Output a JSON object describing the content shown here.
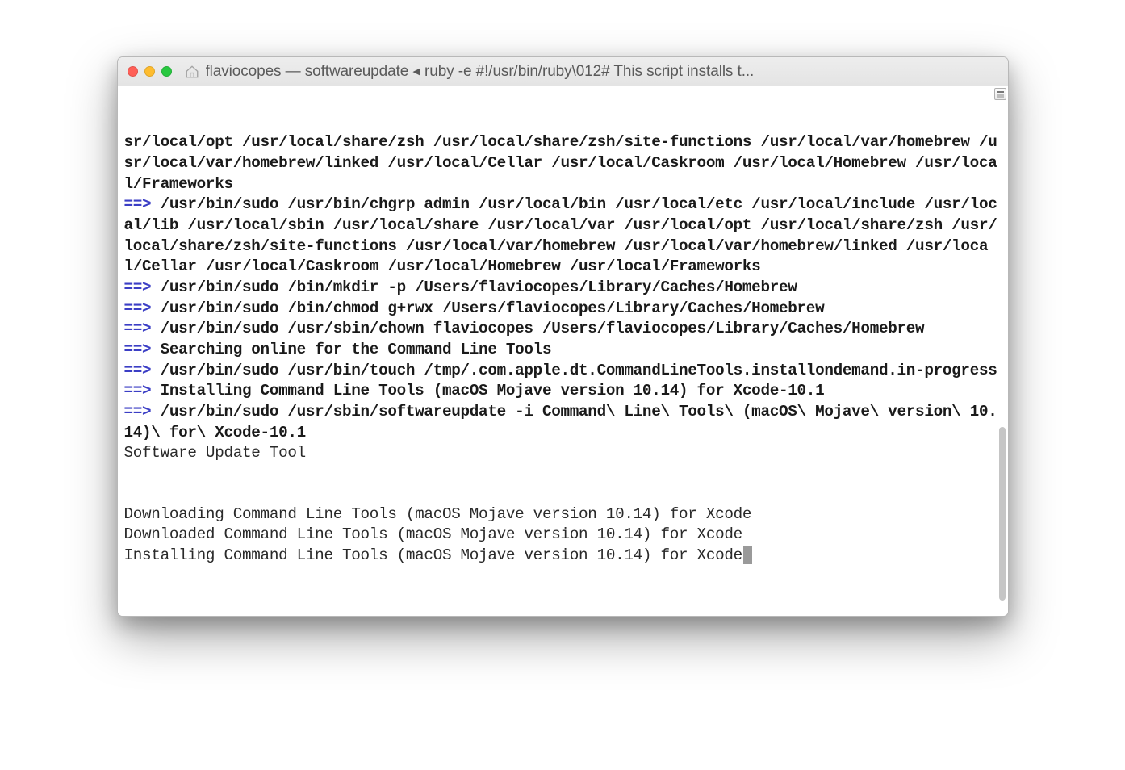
{
  "window": {
    "title": "flaviocopes — softwareupdate ◂ ruby -e #!/usr/bin/ruby\\012# This script installs t..."
  },
  "terminal": {
    "lines": [
      {
        "type": "bold",
        "text": "sr/local/opt /usr/local/share/zsh /usr/local/share/zsh/site-functions /usr/local/var/homebrew /usr/local/var/homebrew/linked /usr/local/Cellar /usr/local/Caskroom /usr/local/Homebrew /usr/local/Frameworks"
      },
      {
        "type": "arrow",
        "prefix": "==>",
        "text": " /usr/bin/sudo /usr/bin/chgrp admin /usr/local/bin /usr/local/etc /usr/local/include /usr/local/lib /usr/local/sbin /usr/local/share /usr/local/var /usr/local/opt /usr/local/share/zsh /usr/local/share/zsh/site-functions /usr/local/var/homebrew /usr/local/var/homebrew/linked /usr/local/Cellar /usr/local/Caskroom /usr/local/Homebrew /usr/local/Frameworks"
      },
      {
        "type": "arrow",
        "prefix": "==>",
        "text": " /usr/bin/sudo /bin/mkdir -p /Users/flaviocopes/Library/Caches/Homebrew"
      },
      {
        "type": "arrow",
        "prefix": "==>",
        "text": " /usr/bin/sudo /bin/chmod g+rwx /Users/flaviocopes/Library/Caches/Homebrew"
      },
      {
        "type": "arrow",
        "prefix": "==>",
        "text": " /usr/bin/sudo /usr/sbin/chown flaviocopes /Users/flaviocopes/Library/Caches/Homebrew"
      },
      {
        "type": "arrow",
        "prefix": "==>",
        "text": " Searching online for the Command Line Tools"
      },
      {
        "type": "arrow",
        "prefix": "==>",
        "text": " /usr/bin/sudo /usr/bin/touch /tmp/.com.apple.dt.CommandLineTools.installondemand.in-progress"
      },
      {
        "type": "arrow",
        "prefix": "==>",
        "text": " Installing Command Line Tools (macOS Mojave version 10.14) for Xcode-10.1"
      },
      {
        "type": "arrow",
        "prefix": "==>",
        "text": " /usr/bin/sudo /usr/sbin/softwareupdate -i Command\\ Line\\ Tools\\ (macOS\\ Mojave\\ version\\ 10.14)\\ for\\ Xcode-10.1"
      },
      {
        "type": "plain",
        "text": "Software Update Tool"
      },
      {
        "type": "plain",
        "text": ""
      },
      {
        "type": "plain",
        "text": ""
      },
      {
        "type": "plain",
        "text": "Downloading Command Line Tools (macOS Mojave version 10.14) for Xcode"
      },
      {
        "type": "plain",
        "text": "Downloaded Command Line Tools (macOS Mojave version 10.14) for Xcode"
      },
      {
        "type": "plain",
        "text": "Installing Command Line Tools (macOS Mojave version 10.14) for Xcode",
        "cursor": true
      }
    ]
  }
}
